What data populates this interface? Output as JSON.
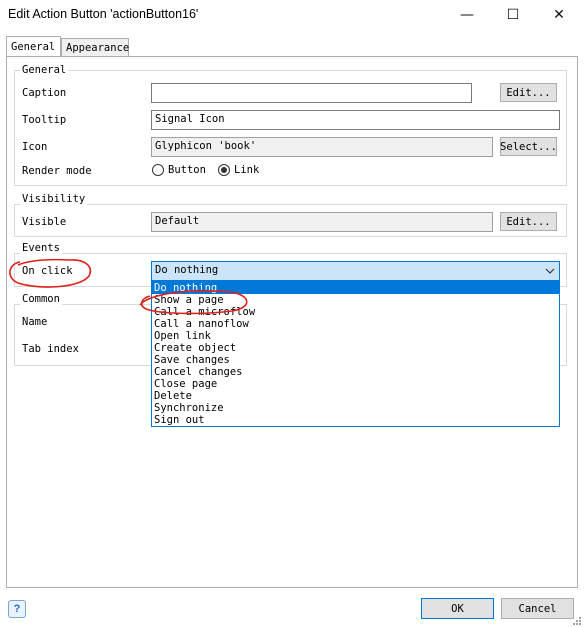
{
  "window": {
    "title": "Edit Action Button 'actionButton16'",
    "controls": {
      "minimize": "—",
      "maximize": "☐",
      "close": "✕"
    }
  },
  "tabs": [
    {
      "label": "General",
      "active": true
    },
    {
      "label": "Appearance",
      "active": false
    }
  ],
  "general": {
    "title": "General",
    "caption_label": "Caption",
    "caption_value": "",
    "caption_edit": "Edit...",
    "tooltip_label": "Tooltip",
    "tooltip_value": "Signal Icon",
    "icon_label": "Icon",
    "icon_value": "Glyphicon 'book'",
    "icon_select": "Select...",
    "render_label": "Render mode",
    "render_options": [
      {
        "label": "Button",
        "checked": false
      },
      {
        "label": "Link",
        "checked": true
      }
    ]
  },
  "visibility": {
    "title": "Visibility",
    "visible_label": "Visible",
    "visible_value": "Default",
    "visible_edit": "Edit..."
  },
  "events": {
    "title": "Events",
    "onclick_label": "On click",
    "onclick_value": "Do nothing",
    "options": [
      "Do nothing",
      "Show a page",
      "Call a microflow",
      "Call a nanoflow",
      "Open link",
      "Create object",
      "Save changes",
      "Cancel changes",
      "Close page",
      "Delete",
      "Synchronize",
      "Sign out"
    ],
    "selected_index": 0
  },
  "common": {
    "title": "Common",
    "name_label": "Name",
    "tabindex_label": "Tab index"
  },
  "footer": {
    "help": "?",
    "ok": "OK",
    "cancel": "Cancel"
  },
  "annotation_color": "#e0201b"
}
